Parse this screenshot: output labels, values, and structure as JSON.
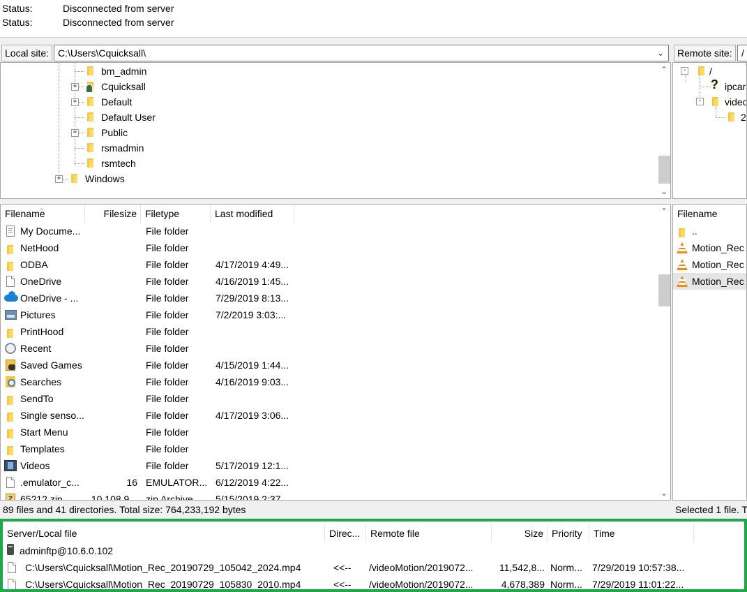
{
  "status_log": [
    {
      "label": "Status:",
      "text": "Disconnected from server"
    },
    {
      "label": "Status:",
      "text": "Disconnected from server"
    }
  ],
  "local_site": {
    "label": "Local site:",
    "path": "C:\\Users\\Cquicksall\\"
  },
  "remote_site": {
    "label": "Remote site:",
    "path": "/"
  },
  "local_tree": [
    {
      "name": "bm_admin",
      "icon": "folder-icon",
      "expandable": false
    },
    {
      "name": "Cquicksall",
      "icon": "user-folder-icon",
      "expandable": true
    },
    {
      "name": "Default",
      "icon": "folder-icon",
      "expandable": true
    },
    {
      "name": "Default User",
      "icon": "folder-icon",
      "expandable": false
    },
    {
      "name": "Public",
      "icon": "folder-icon",
      "expandable": true
    },
    {
      "name": "rsmadmin",
      "icon": "folder-icon",
      "expandable": false
    },
    {
      "name": "rsmtech",
      "icon": "folder-icon",
      "expandable": false
    },
    {
      "name": "Windows",
      "icon": "folder-icon",
      "expandable": true
    }
  ],
  "remote_tree": [
    {
      "name": "/",
      "icon": "folder-icon",
      "expander": "minus"
    },
    {
      "name": "ipcar",
      "icon": "question-icon",
      "expander": ""
    },
    {
      "name": "videc",
      "icon": "folder-icon",
      "expander": "minus"
    },
    {
      "name": "2",
      "icon": "folder-icon",
      "expander": ""
    }
  ],
  "local_list": {
    "columns": [
      "Filename",
      "Filesize",
      "Filetype",
      "Last modified"
    ],
    "rows": [
      {
        "name": "My Docume...",
        "size": "",
        "type": "File folder",
        "modified": "",
        "icon": "document-folder-icon"
      },
      {
        "name": "NetHood",
        "size": "",
        "type": "File folder",
        "modified": "",
        "icon": "folder-icon"
      },
      {
        "name": "ODBA",
        "size": "",
        "type": "File folder",
        "modified": "4/17/2019 4:49...",
        "icon": "folder-icon"
      },
      {
        "name": "OneDrive",
        "size": "",
        "type": "File folder",
        "modified": "4/16/2019 1:45...",
        "icon": "file-icon"
      },
      {
        "name": "OneDrive - ...",
        "size": "",
        "type": "File folder",
        "modified": "7/29/2019 8:13...",
        "icon": "cloud-icon"
      },
      {
        "name": "Pictures",
        "size": "",
        "type": "File folder",
        "modified": "7/2/2019 3:03:...",
        "icon": "pictures-icon"
      },
      {
        "name": "PrintHood",
        "size": "",
        "type": "File folder",
        "modified": "",
        "icon": "folder-icon"
      },
      {
        "name": "Recent",
        "size": "",
        "type": "File folder",
        "modified": "",
        "icon": "recent-icon"
      },
      {
        "name": "Saved Games",
        "size": "",
        "type": "File folder",
        "modified": "4/15/2019 1:44...",
        "icon": "saved-games-icon"
      },
      {
        "name": "Searches",
        "size": "",
        "type": "File folder",
        "modified": "4/16/2019 9:03...",
        "icon": "searches-icon"
      },
      {
        "name": "SendTo",
        "size": "",
        "type": "File folder",
        "modified": "",
        "icon": "folder-icon"
      },
      {
        "name": "Single senso...",
        "size": "",
        "type": "File folder",
        "modified": "4/17/2019 3:06...",
        "icon": "folder-icon"
      },
      {
        "name": "Start Menu",
        "size": "",
        "type": "File folder",
        "modified": "",
        "icon": "folder-icon"
      },
      {
        "name": "Templates",
        "size": "",
        "type": "File folder",
        "modified": "",
        "icon": "folder-icon"
      },
      {
        "name": "Videos",
        "size": "",
        "type": "File folder",
        "modified": "5/17/2019 12:1...",
        "icon": "videos-icon"
      },
      {
        "name": ".emulator_c...",
        "size": "16",
        "type": "EMULATOR...",
        "modified": "6/12/2019 4:22...",
        "icon": "file-icon"
      },
      {
        "name": "65212.zip",
        "size": "10,108,9...",
        "type": "zip Archive",
        "modified": "5/15/2019 2:37...",
        "icon": "zip-icon"
      }
    ],
    "status": "89 files and 41 directories. Total size: 764,233,192 bytes"
  },
  "remote_list": {
    "columns": [
      "Filename"
    ],
    "rows": [
      {
        "name": "..",
        "icon": "folder-icon"
      },
      {
        "name": "Motion_Rec",
        "icon": "vlc-icon"
      },
      {
        "name": "Motion_Rec",
        "icon": "vlc-icon"
      },
      {
        "name": "Motion_Rec",
        "icon": "vlc-icon"
      }
    ],
    "status": "Selected 1 file. T"
  },
  "queue": {
    "columns": [
      "Server/Local file",
      "Direc...",
      "Remote file",
      "Size",
      "Priority",
      "Time"
    ],
    "server": "adminftp@10.6.0.102",
    "rows": [
      {
        "local": "C:\\Users\\Cquicksall\\Motion_Rec_20190729_105042_2024.mp4",
        "direction": "<<--",
        "remote": "/videoMotion/2019072...",
        "size": "11,542,8...",
        "priority": "Norm...",
        "time": "7/29/2019 10:57:38..."
      },
      {
        "local": "C:\\Users\\Cquicksall\\Motion_Rec_20190729_105830_2010.mp4",
        "direction": "<<--",
        "remote": "/videoMotion/2019072...",
        "size": "4,678,389",
        "priority": "Norm...",
        "time": "7/29/2019 11:01:22..."
      }
    ]
  },
  "colors": {
    "queue_highlight_border": "#1fa84a",
    "folder": "#f5c842",
    "panel_bg": "#ffffff",
    "chrome_bg": "#f0f0f0"
  }
}
